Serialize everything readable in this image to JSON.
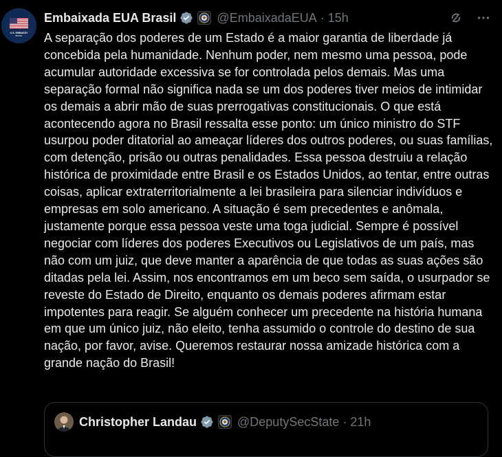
{
  "tweet": {
    "author_name": "Embaixada EUA Brasil",
    "handle": "@EmbaixadaEUA",
    "separator": "·",
    "time": "15h",
    "avatar_caption": "U.S. EMBASSY",
    "avatar_subcaption": "BRASIL",
    "text": "A separação dos poderes de um Estado é a maior garantia de liberdade já concebida pela humanidade. Nenhum poder, nem mesmo uma pessoa, pode acumular autoridade excessiva se for controlada pelos demais. Mas uma separação formal não significa nada se um dos poderes tiver meios de intimidar os demais a abrir mão de suas prerrogativas constitucionais. O que está acontecendo agora no Brasil ressalta esse ponto: um único ministro do STF usurpou poder ditatorial ao ameaçar líderes dos outros poderes, ou suas famílias, com detenção, prisão ou outras penalidades. Essa pessoa destruiu a relação histórica de proximidade entre Brasil e os Estados Unidos, ao tentar, entre outras coisas, aplicar extraterritorialmente a lei brasileira para silenciar indivíduos e empresas em solo americano. A situação é sem precedentes e anômala, justamente porque essa pessoa veste uma toga judicial. Sempre é possível negociar com líderes dos poderes Executivos ou Legislativos de um país, mas não com um juiz, que deve manter a aparência de que todas as suas ações são ditadas pela lei. Assim, nos encontramos em um beco sem saída, o usurpador se reveste do Estado de Direito, enquanto os demais poderes afirmam estar impotentes para reagir. Se alguém conhecer um precedente na história humana em que um único juiz, não eleito, tenha assumido o controle do destino de sua nação, por favor, avise. Queremos restaurar nossa amizade histórica com a grande nação do Brasil!"
  },
  "quoted_tweet": {
    "author_name": "Christopher Landau",
    "handle": "@DeputySecState",
    "separator": "·",
    "time": "21h"
  },
  "icons": {
    "verified": "verified-badge-icon",
    "affiliation": "us-seal-icon",
    "grok": "grok-icon",
    "more": "more-options-icon"
  },
  "colors": {
    "background": "#000000",
    "text": "#e7e9ea",
    "secondary": "#71767b",
    "verified": "#829aab",
    "border": "#2f3336"
  }
}
